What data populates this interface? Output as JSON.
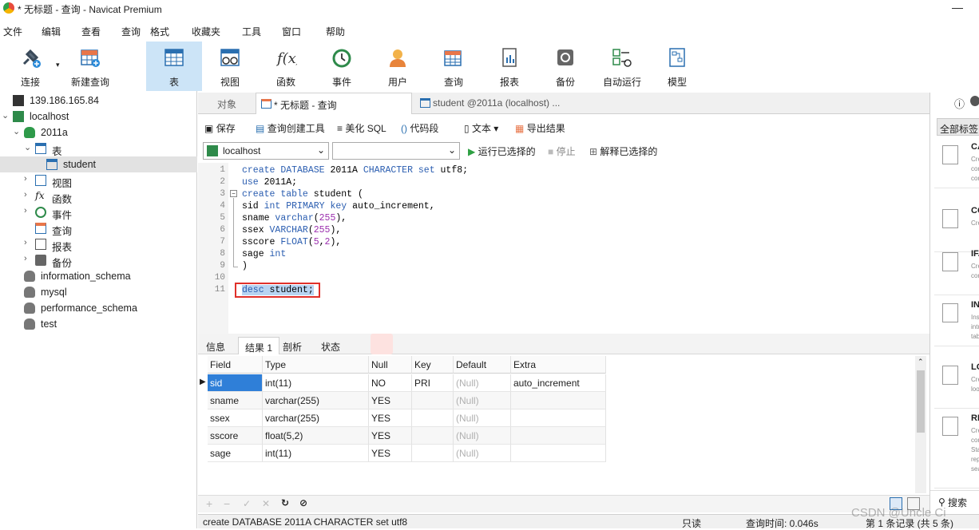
{
  "window": {
    "title": "* 无标题 - 查询 - Navicat Premium",
    "minimize": "—"
  },
  "menu": [
    "文件",
    "编辑",
    "查看",
    "查询",
    "格式",
    "收藏夹",
    "工具",
    "窗口",
    "帮助"
  ],
  "toolbar": [
    {
      "label": "连接",
      "icon": "plug-icon"
    },
    {
      "label": "新建查询",
      "icon": "new-query-icon"
    },
    {
      "label": "表",
      "icon": "table-icon",
      "selected": true
    },
    {
      "label": "视图",
      "icon": "view-icon"
    },
    {
      "label": "函数",
      "icon": "function-icon"
    },
    {
      "label": "事件",
      "icon": "clock-icon"
    },
    {
      "label": "用户",
      "icon": "user-icon"
    },
    {
      "label": "查询",
      "icon": "query-icon"
    },
    {
      "label": "报表",
      "icon": "report-icon"
    },
    {
      "label": "备份",
      "icon": "backup-icon"
    },
    {
      "label": "自动运行",
      "icon": "autorun-icon"
    },
    {
      "label": "模型",
      "icon": "model-icon"
    }
  ],
  "tree": [
    {
      "label": "139.186.165.84",
      "level": 0,
      "icon": "connection-icon"
    },
    {
      "label": "localhost",
      "level": 0,
      "icon": "connection-icon",
      "arrow": "⌄"
    },
    {
      "label": "2011a",
      "level": 1,
      "icon": "database-icon",
      "arrow": "⌄"
    },
    {
      "label": "表",
      "level": 2,
      "icon": "table-icon",
      "arrow": "⌄"
    },
    {
      "label": "student",
      "level": 3,
      "icon": "table-icon",
      "selected": true
    },
    {
      "label": "视图",
      "level": 2,
      "icon": "view-icon",
      "arrow": "›"
    },
    {
      "label": "函数",
      "level": 2,
      "icon": "function-icon",
      "arrow": "›"
    },
    {
      "label": "事件",
      "level": 2,
      "icon": "clock-icon",
      "arrow": "›"
    },
    {
      "label": "查询",
      "level": 2,
      "icon": "query-icon"
    },
    {
      "label": "报表",
      "level": 2,
      "icon": "report-icon",
      "arrow": "›"
    },
    {
      "label": "备份",
      "level": 2,
      "icon": "backup-icon",
      "arrow": "›"
    },
    {
      "label": "information_schema",
      "level": 1,
      "icon": "database-icon"
    },
    {
      "label": "mysql",
      "level": 1,
      "icon": "database-icon"
    },
    {
      "label": "performance_schema",
      "level": 1,
      "icon": "database-icon"
    },
    {
      "label": "test",
      "level": 1,
      "icon": "database-icon"
    }
  ],
  "tabs": {
    "objects": "对象",
    "active": "* 无标题 - 查询",
    "other": "student @2011a (localhost) ..."
  },
  "editor_toolbar": {
    "save": "保存",
    "builder": "查询创建工具",
    "beautify": "美化 SQL",
    "snippet": "代码段",
    "text": "文本",
    "export": "导出结果"
  },
  "conn_bar": {
    "connection": "localhost",
    "database": "",
    "run": "运行已选择的",
    "stop": "停止",
    "explain": "解释已选择的"
  },
  "sql_lines": [
    "create DATABASE 2011A CHARACTER set utf8;",
    "use 2011A;",
    "create table student (",
    "sid int PRIMARY key auto_increment,",
    "sname varchar(255),",
    "ssex VARCHAR(255),",
    "sscore FLOAT(5,2),",
    "sage int",
    ")",
    "",
    "desc student;"
  ],
  "result_tabs": [
    "信息",
    "结果 1",
    "剖析",
    "状态"
  ],
  "grid": {
    "columns": [
      "Field",
      "Type",
      "Null",
      "Key",
      "Default",
      "Extra"
    ],
    "rows": [
      [
        "sid",
        "int(11)",
        "NO",
        "PRI",
        "(Null)",
        "auto_increment"
      ],
      [
        "sname",
        "varchar(255)",
        "YES",
        "",
        "(Null)",
        ""
      ],
      [
        "ssex",
        "varchar(255)",
        "YES",
        "",
        "(Null)",
        ""
      ],
      [
        "sscore",
        "float(5,2)",
        "YES",
        "",
        "(Null)",
        ""
      ],
      [
        "sage",
        "int(11)",
        "YES",
        "",
        "(Null)",
        ""
      ]
    ]
  },
  "status": {
    "sql": "create DATABASE 2011A CHARACTER set utf8",
    "readonly": "只读",
    "time": "查询时间: 0.046s",
    "records": "第 1 条记录 (共 5 条)"
  },
  "right_panel": {
    "all_tags": "全部标签",
    "search": "搜索",
    "snippets": [
      {
        "title": "CA",
        "desc": "Cre cor cor"
      },
      {
        "title": "CO",
        "desc": "Cre"
      },
      {
        "title": "IF.",
        "desc": "Cre cor"
      },
      {
        "title": "IN",
        "desc": "Ins intu tab"
      },
      {
        "title": "LO",
        "desc": "Cre loo"
      },
      {
        "title": "RE",
        "desc": "Cre cor Sta rep sea"
      }
    ]
  },
  "watermark": "CSDN @Uncle Ci"
}
